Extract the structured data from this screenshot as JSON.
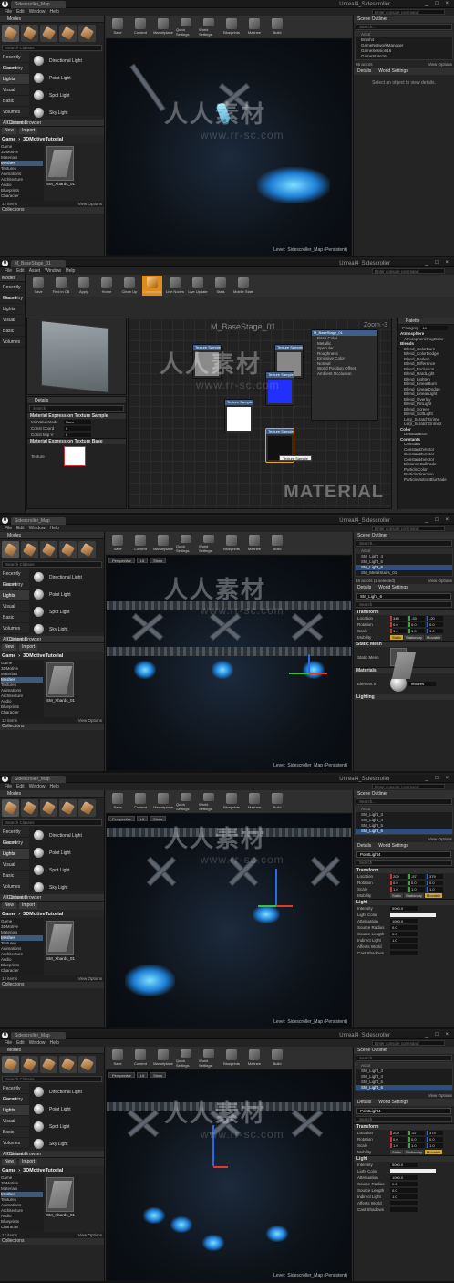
{
  "app": {
    "editor_title": "Unreal4_Sidescroller",
    "doc_tab": "Sidescroller_Map",
    "material_tab": "M_BaseStage_01",
    "menus": [
      "File",
      "Edit",
      "Window",
      "Help"
    ],
    "material_menus": [
      "File",
      "Edit",
      "Asset",
      "Window",
      "Help"
    ],
    "command_placeholder": "Enter console command",
    "window_controls": "_ □ ×",
    "logo": "U"
  },
  "modes": {
    "tab": "Modes",
    "search_placeholder": "Search Classes",
    "categories": [
      "Recently Placed",
      "Geometry",
      "Lights",
      "Visual",
      "Basic",
      "Volumes",
      "All Classes"
    ],
    "light_items": [
      "Directional Light",
      "Point Light",
      "Spot Light",
      "Sky Light"
    ]
  },
  "content_browser": {
    "tab": "Content Browser",
    "new_label": "New",
    "import_label": "Import",
    "path_root": "Game",
    "path_folder": "3DMotiveTutorial",
    "filters_label": "Filters",
    "search_placeholder": "Search Folder",
    "tree": [
      "Game",
      "3DMotive",
      "Materials",
      "Meshes",
      "Textures",
      "Animations",
      "Architecture",
      "Audio",
      "Blueprints",
      "Character"
    ],
    "asset_name": "SM_Xbards_01",
    "item_count": "12 items",
    "view_options": "View Options",
    "collections_label": "Collections"
  },
  "toolbar": {
    "buttons": [
      "Save",
      "Content",
      "Marketplace",
      "Quick Settings",
      "World Settings",
      "Blueprints",
      "Matinee",
      "Build"
    ]
  },
  "material_toolbar": {
    "buttons": [
      "Save",
      "Find in CB",
      "Apply",
      "Home",
      "Clean Up",
      "Connectors",
      "Live Nodes",
      "Live Update",
      "Stats",
      "Mobile Stats"
    ]
  },
  "viewport": {
    "buttons": [
      "Perspective",
      "Lit",
      "Show"
    ],
    "level_label": "Level:",
    "level_name": "Sidescroller_Map (Persistent)"
  },
  "outliner": {
    "tab": "Scene Outliner",
    "search_placeholder": "Search...",
    "column": "Actor",
    "frame1_rows": [
      "Brush4",
      "GameNetworkManager",
      "GameSession16",
      "GameState16"
    ],
    "frame1_count": "66 actors",
    "frame3_rows": [
      "SM_Light_4",
      "SM_Light_5",
      "SM_Light_6",
      "SM_MetalStairs_01"
    ],
    "frame3_count": "48 actors (1 selected)",
    "frame4_rows": [
      "SM_Light_3",
      "SM_Light_4",
      "SM_Light_5",
      "SM_Light_6"
    ],
    "view_options": "View Options"
  },
  "details": {
    "tab": "Details",
    "world_settings_tab": "World Settings",
    "empty_message": "Select an object to view details.",
    "frame3_name": "SM_Light_6",
    "frame4_name": "PointLight4",
    "search_placeholder": "Search",
    "transform_section": "Transform",
    "location_label": "Location",
    "rotation_label": "Rotation",
    "scale_label": "Scale",
    "mobility_label": "Mobility",
    "mobility_options": [
      "Static",
      "Stationary",
      "Movable"
    ],
    "frame3_location": [
      "348",
      "-33",
      "-20"
    ],
    "frame3_rotation": [
      "0.0",
      "0.0",
      "0.0"
    ],
    "frame3_scale": [
      "1.0",
      "1.0",
      "1.0"
    ],
    "frame4_location": [
      "209",
      "-57",
      "379"
    ],
    "frame4_rotation": [
      "0.0",
      "0.0",
      "0.0"
    ],
    "frame4_scale": [
      "1.0",
      "1.0",
      "1.0"
    ],
    "frame5_location": [
      "209",
      "-57",
      "379"
    ],
    "static_mesh_section": "Static Mesh",
    "static_mesh_label": "Static Mesh",
    "materials_section": "Materials",
    "element_label": "Element 0",
    "textures_label": "Textures",
    "lighting_section": "Lighting",
    "light_section": "Light",
    "light_props": [
      "Intensity",
      "Light Color",
      "Attenuation",
      "Source Radius",
      "Source Length",
      "Indirect Light",
      "Affects World",
      "Cast Shadows"
    ],
    "light_values": [
      "5000.0",
      "",
      "1000.0",
      "0.0",
      "0.0",
      "1.0",
      "",
      ""
    ]
  },
  "material": {
    "graph_title": "M_BaseStage_01",
    "zoom": "Zoom -3",
    "watermark": "MATERIAL",
    "node_texture_sample": "Texture Sample",
    "node_result": "M_BaseStage_01",
    "result_pins": [
      "Base Color",
      "Metallic",
      "Specular",
      "Roughness",
      "Emissive Color",
      "Normal",
      "World Position Offset",
      "Ambient Occlusion"
    ],
    "tooltip": "Texture Sample",
    "details_tab": "Details",
    "details_search": "Search",
    "section_expr": "Material Expression Texture Sample",
    "props": [
      "MipValueMode",
      "Const Coord",
      "Const Mip V"
    ],
    "prop_values": [
      "None",
      "0",
      "0"
    ],
    "section_base": "Material Expression Texture Base",
    "texture_label": "Texture",
    "palette_tab": "Palette",
    "palette_category_label": "Category",
    "palette_category": "All",
    "palette": [
      {
        "h": "Atmosphere"
      },
      {
        "i": "AtmosphericFogColor"
      },
      {
        "h": "Blends"
      },
      {
        "i": "Blend_ColorBurn"
      },
      {
        "i": "Blend_ColorDodge"
      },
      {
        "i": "Blend_Darken"
      },
      {
        "i": "Blend_Difference"
      },
      {
        "i": "Blend_Exclusion"
      },
      {
        "i": "Blend_HardLight"
      },
      {
        "i": "Blend_Lighten"
      },
      {
        "i": "Blend_LinearBurn"
      },
      {
        "i": "Blend_LinearDodge"
      },
      {
        "i": "Blend_LinearLight"
      },
      {
        "i": "Blend_Overlay"
      },
      {
        "i": "Blend_PinLight"
      },
      {
        "i": "Blend_Screen"
      },
      {
        "i": "Blend_SoftLight"
      },
      {
        "i": "Lerp_ScratchGrime"
      },
      {
        "i": "Lerp_ScratchGrime2"
      },
      {
        "h": "Color"
      },
      {
        "i": "Desaturation"
      },
      {
        "h": "Constants"
      },
      {
        "i": "Constant"
      },
      {
        "i": "Constant2Vector"
      },
      {
        "i": "Constant3Vector"
      },
      {
        "i": "Constant4Vector"
      },
      {
        "i": "DistanceCullFade"
      },
      {
        "i": "ParticleColor"
      },
      {
        "i": "ParticleDirection"
      },
      {
        "i": "ParticleMotionBlurFade"
      }
    ]
  },
  "watermark": {
    "cn": "人人素材",
    "url": "www.rr-sc.com"
  },
  "colors": {
    "accent_orange": "#e08c1a",
    "selection_blue": "#2d4f7a",
    "light_glow": "#7de0ff"
  }
}
